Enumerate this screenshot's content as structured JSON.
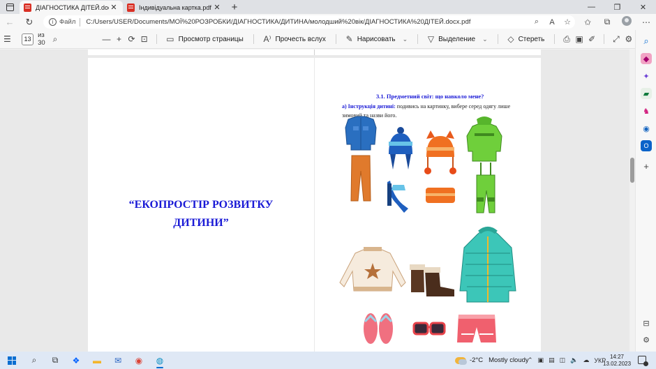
{
  "tabs": [
    {
      "title": "ДІАГНОСТИКА ДІТЕЙ.docx.pdf",
      "active": true
    },
    {
      "title": "Індивідуальна картка.pdf",
      "active": false
    }
  ],
  "address": {
    "label": "Файл",
    "url": "C:/Users/USER/Documents/МОЇ%20РОЗРОБКИ/ДІАГНОСТИКА/ДИТИНА/молодший%20вік/ДІАГНОСТИКА%20ДІТЕЙ.docx.pdf"
  },
  "pdf_toolbar": {
    "page_current": "13",
    "page_total": "из 30",
    "page_view": "Просмотр страницы",
    "read_aloud": "Прочесть вслух",
    "draw": "Нарисовать",
    "highlight": "Выделение",
    "erase": "Стереть"
  },
  "document": {
    "left_slogan_line1": "“ЕКОПРОСТІР РОЗВИТКУ",
    "left_slogan_line2": "ДИТИНИ”",
    "section_title": "3.1. Предметний світ: що навколо мене?",
    "instruction_label": "а) Інструкція дитині:",
    "instruction_text": " подивись на картинку, вибере серед одягу лише зимовий та назви його."
  },
  "taskbar": {
    "weather_temp": "-2°C",
    "weather_text": "Mostly cloudy",
    "language": "УКР",
    "time": "14:27",
    "date": "13.02.2023"
  },
  "colors": {
    "heading_blue": "#1a1ad6",
    "accent": "#0a6ed1"
  }
}
